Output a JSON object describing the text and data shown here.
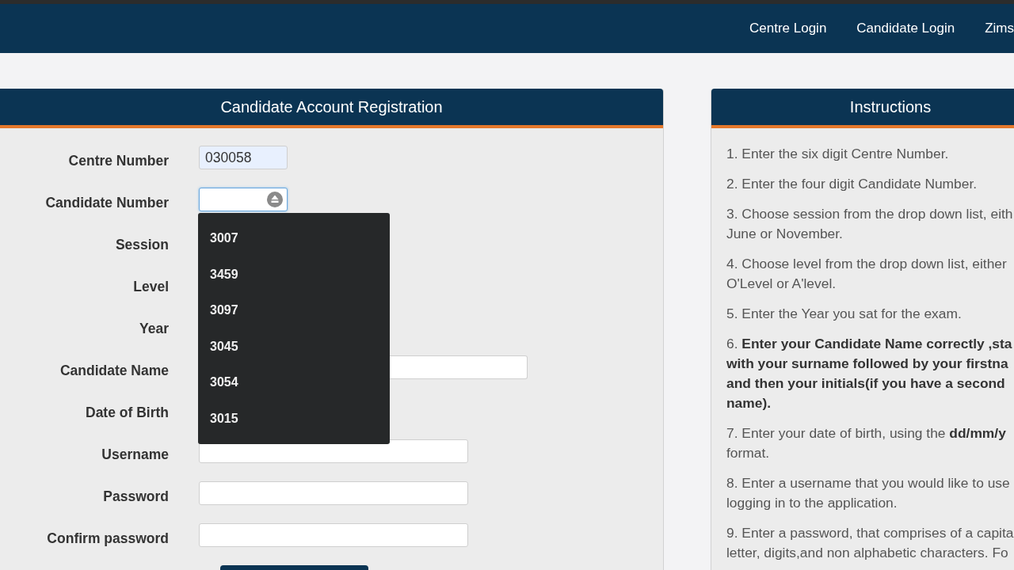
{
  "navbar": {
    "links": [
      {
        "label": "Centre Login"
      },
      {
        "label": "Candidate Login"
      },
      {
        "label": "Zims"
      }
    ]
  },
  "registration": {
    "title": "Candidate Account Registration",
    "fields": [
      {
        "label": "Centre Number",
        "kind": "short",
        "value": "030058",
        "autofilled": true,
        "focused": false
      },
      {
        "label": "Candidate Number",
        "kind": "short",
        "autofilled": false,
        "focused": true,
        "suggestions": [
          "3007",
          "3459",
          "3097",
          "3045",
          "3054",
          "3015"
        ]
      },
      {
        "label": "Session",
        "kind": "covered"
      },
      {
        "label": "Level",
        "kind": "covered"
      },
      {
        "label": "Year",
        "kind": "covered"
      },
      {
        "label": "Candidate Name",
        "kind": "wide",
        "autofilled": false,
        "focused": false
      },
      {
        "label": "Date of Birth",
        "kind": "covered"
      },
      {
        "label": "Username",
        "kind": "medium",
        "autofilled": false,
        "focused": false
      },
      {
        "label": "Password",
        "kind": "medium",
        "autofilled": false,
        "focused": false
      },
      {
        "label": "Confirm password",
        "kind": "medium",
        "autofilled": false,
        "focused": false
      }
    ]
  },
  "instructions": {
    "title": "Instructions",
    "steps": [
      {
        "lines": [
          "1. Enter the six digit Centre Number."
        ]
      },
      {
        "lines": [
          "2. Enter the four digit Candidate Number."
        ]
      },
      {
        "lines": [
          "3. Choose session from the drop down list, eith",
          "June or November."
        ]
      },
      {
        "lines": [
          "4. Choose level from the drop down list, either",
          "O'Level or A'level."
        ]
      },
      {
        "lines": [
          "5. Enter the Year you sat for the exam."
        ]
      },
      {
        "lines": [
          "6. **Enter your Candidate Name correctly ,sta**",
          "**with your surname followed by your firstna**",
          "**and then your initials(if you have a second**",
          "**name).**"
        ]
      },
      {
        "lines": [
          "7. Enter your date of birth, using the **dd/mm/y**",
          "format."
        ]
      },
      {
        "lines": [
          "8. Enter a username that you would like to use",
          "logging in to the application."
        ]
      },
      {
        "lines": [
          "9. Enter a password, that comprises of a capita",
          "letter, digits,and non alphabetic characters. Fo"
        ]
      }
    ]
  }
}
